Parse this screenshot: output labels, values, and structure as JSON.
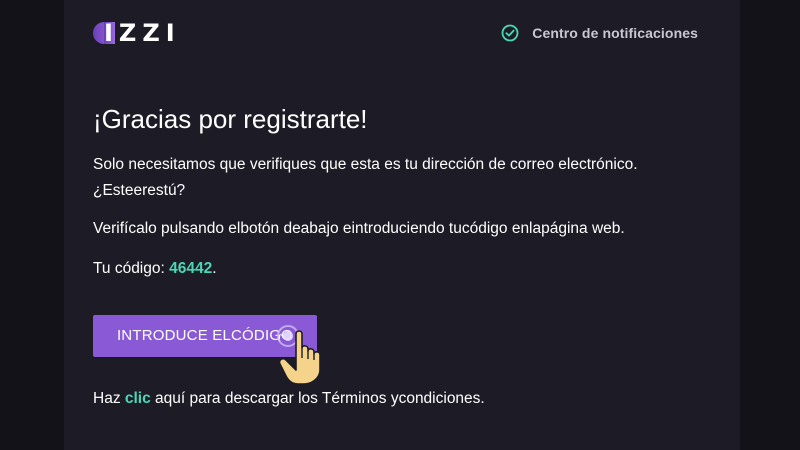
{
  "brand": {
    "logo_text": "IZZI",
    "accent": "#8a5ad6",
    "highlight": "#49d8b6"
  },
  "header": {
    "notification_center": "Centro de notificaciones"
  },
  "email": {
    "title": "¡Gracias por registrarte!",
    "line1": "Solo necesitamos que verifiques que esta es tu dirección de correo electrónico.",
    "line1b": "¿Esteerestú?",
    "line2": "Verifícalo pulsando elbotón deabajo eintroduciendo tucódigo enlapágina web.",
    "code_label": "Tu código: ",
    "code_value": "46442",
    "code_suffix": ".",
    "cta_label": "INTRODUCE ELCÓDIGO",
    "terms_prefix": "Haz ",
    "terms_link": "clic",
    "terms_suffix": " aquí para descargar los Términos ycondiciones."
  },
  "icons": {
    "notification": "check-circle-icon",
    "pointer": "pointing-hand-icon"
  }
}
